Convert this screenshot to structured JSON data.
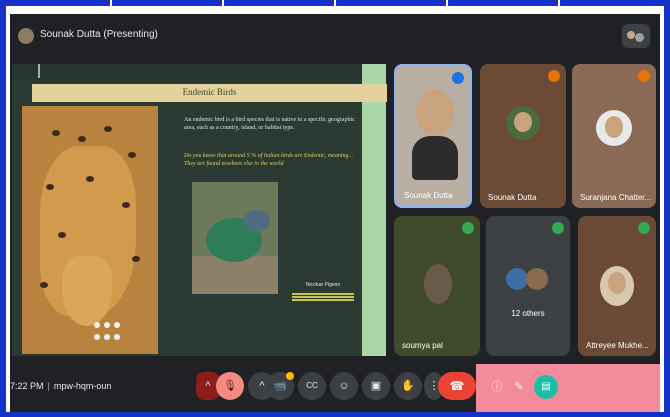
{
  "titlebar": {
    "presenter_label": "Sounak Dutta (Presenting)",
    "presenter_icon": "presenter-avatar-icon",
    "people_icon": "participants-avatars-icon"
  },
  "slide": {
    "banner_title": "Endemic Birds",
    "text_intro": "An endemic bird is a bird species that is native to a specific geographic area, such as a country, island, or habitat type.",
    "text_highlight": "Do you know that around 5 % of Indian birds are Endemic, meaning... They are found nowhere else in the world",
    "photo_caption": "Nicobar Pigeon"
  },
  "participants": [
    {
      "name": "Sounak Dutta",
      "mic_icon": "mic-muted-icon",
      "mic_color": "#1a73e8"
    },
    {
      "name": "Sounak Dutta",
      "mic_icon": "mic-muted-icon",
      "mic_color": "#e8710a"
    },
    {
      "name": "Suranjana Chatter...",
      "mic_icon": "mic-muted-icon",
      "mic_color": "#e8710a"
    },
    {
      "name": "soumya pal",
      "mic_icon": "mic-on-icon",
      "mic_color": "#34a853"
    },
    {
      "name": "12 others",
      "mic_icon": "mic-on-icon",
      "mic_color": "#34a853"
    },
    {
      "name": "Attreyee Mukhe...",
      "mic_icon": "mic-on-icon",
      "mic_color": "#34a853"
    }
  ],
  "bottombar": {
    "time": "7:22 PM",
    "separator": "|",
    "meeting_code": "mpw-hqm-oun",
    "controls": {
      "mic_glyph": "🎙",
      "camera_glyph": "📹",
      "captions_glyph": "CC",
      "emoji_glyph": "☺",
      "present_glyph": "▣",
      "raise_hand_glyph": "✋",
      "more_glyph": "⋮",
      "hangup_glyph": "☎",
      "info_glyph": "ⓘ",
      "chat_glyph": "✎",
      "activities_glyph": "▤"
    }
  },
  "colors": {
    "frame": "#1432c8",
    "meet_bg": "#202124",
    "hangup": "#ea4335",
    "side_panel": "#f28b9a",
    "accent_teal": "#1bbfa8"
  }
}
